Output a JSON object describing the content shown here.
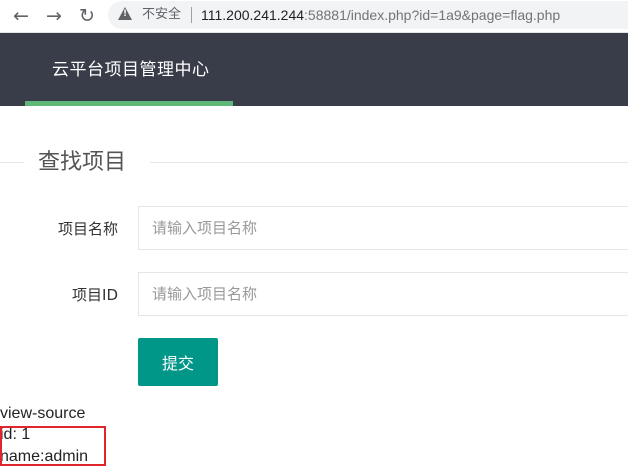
{
  "browser": {
    "insecure_label": "不安全",
    "url_host": "111.200.241.244",
    "url_rest": ":58881/index.php?id=1a9&page=flag.php"
  },
  "header": {
    "title": "云平台项目管理中心"
  },
  "form": {
    "legend": "查找项目",
    "name_label": "项目名称",
    "name_placeholder": "请输入项目名称",
    "id_label": "项目ID",
    "id_placeholder": "请输入项目名称",
    "submit_label": "提交"
  },
  "output": {
    "line1": "view-source",
    "line2": "id: 1",
    "line3": "name:admin"
  },
  "colors": {
    "header_bg": "#393d49",
    "header_active": "#5fb878",
    "button": "#009688",
    "highlight": "#e0262b"
  }
}
